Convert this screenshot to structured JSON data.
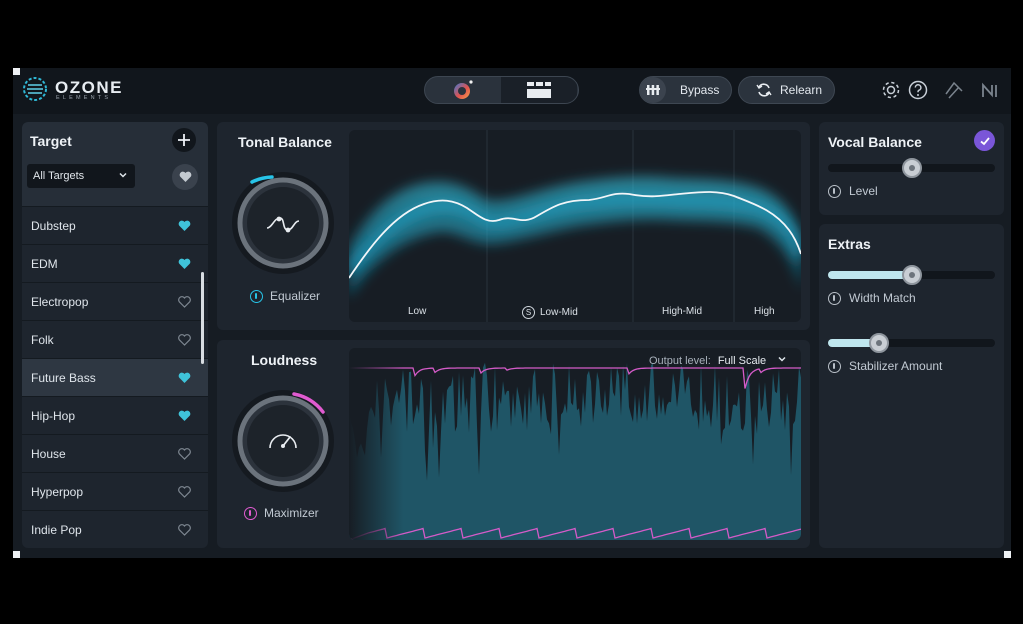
{
  "app": {
    "brand": "OZONE",
    "brand_sub": "ELEMENTS"
  },
  "header": {
    "bypass_label": "Bypass",
    "relearn_label": "Relearn"
  },
  "target": {
    "title": "Target",
    "selected_value": "All Targets",
    "items": [
      {
        "label": "Dubstep",
        "favorite": true
      },
      {
        "label": "EDM",
        "favorite": true
      },
      {
        "label": "Electropop",
        "favorite": false
      },
      {
        "label": "Folk",
        "favorite": false
      },
      {
        "label": "Future Bass",
        "favorite": true,
        "selected": true
      },
      {
        "label": "Hip-Hop",
        "favorite": true
      },
      {
        "label": "House",
        "favorite": false
      },
      {
        "label": "Hyperpop",
        "favorite": false
      },
      {
        "label": "Indie Pop",
        "favorite": false
      }
    ]
  },
  "tonal": {
    "title": "Tonal Balance",
    "module_label": "Equalizer",
    "bands": [
      "Low",
      "Low-Mid",
      "High-Mid",
      "High"
    ],
    "low_mid_badge": "S"
  },
  "loudness": {
    "title": "Loudness",
    "module_label": "Maximizer",
    "output_level_label": "Output level:",
    "output_level_value": "Full Scale"
  },
  "vocal": {
    "title": "Vocal Balance",
    "checked": true,
    "level_label": "Level",
    "level": 0.5
  },
  "extras": {
    "title": "Extras",
    "width_label": "Width Match",
    "width": 0.5,
    "stabilizer_label": "Stabilizer Amount",
    "stabilizer": 0.28
  },
  "colors": {
    "accent_cyan": "#27c4e8",
    "accent_pink": "#e05bd0",
    "accent_purple": "#7a56d8",
    "favorite_heart": "#3fc3d9"
  },
  "icons": {
    "logo": "ozone-logo-icon",
    "mode_left": "assistant-orb-icon",
    "mode_right": "modules-grid-icon",
    "bypass": "bypass-bars-icon",
    "relearn": "refresh-icon",
    "settings": "gear-icon",
    "help": "help-icon",
    "ni": "ni-logo-icon",
    "heart": "heart-icon"
  }
}
